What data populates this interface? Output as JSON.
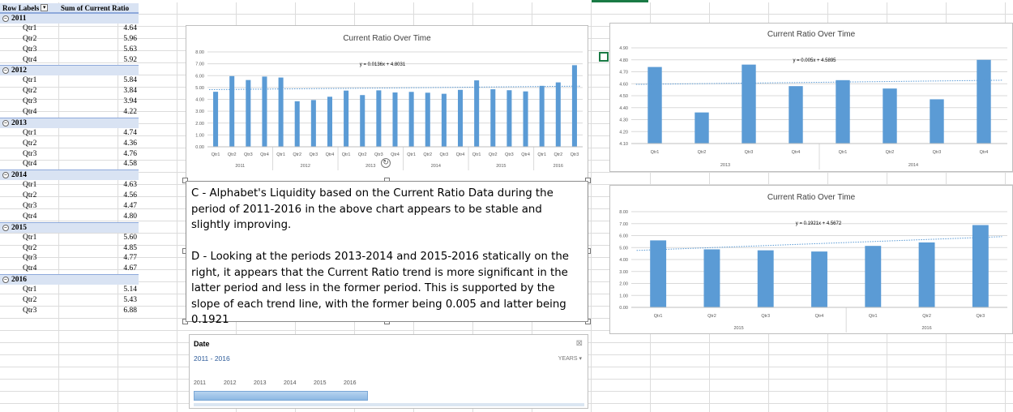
{
  "pivot": {
    "header_row_labels": "Row Labels",
    "header_sum": "Sum of Current Ratio",
    "filter_icon": "filter-icon",
    "years": [
      {
        "year": "2011",
        "rows": [
          {
            "q": "Qtr1",
            "v": "4.64"
          },
          {
            "q": "Qtr2",
            "v": "5.96"
          },
          {
            "q": "Qtr3",
            "v": "5.63"
          },
          {
            "q": "Qtr4",
            "v": "5.92"
          }
        ]
      },
      {
        "year": "2012",
        "rows": [
          {
            "q": "Qtr1",
            "v": "5.84"
          },
          {
            "q": "Qtr2",
            "v": "3.84"
          },
          {
            "q": "Qtr3",
            "v": "3.94"
          },
          {
            "q": "Qtr4",
            "v": "4.22"
          }
        ]
      },
      {
        "year": "2013",
        "rows": [
          {
            "q": "Qtr1",
            "v": "4.74"
          },
          {
            "q": "Qtr2",
            "v": "4.36"
          },
          {
            "q": "Qtr3",
            "v": "4.76"
          },
          {
            "q": "Qtr4",
            "v": "4.58"
          }
        ]
      },
      {
        "year": "2014",
        "rows": [
          {
            "q": "Qtr1",
            "v": "4.63"
          },
          {
            "q": "Qtr2",
            "v": "4.56"
          },
          {
            "q": "Qtr3",
            "v": "4.47"
          },
          {
            "q": "Qtr4",
            "v": "4.80"
          }
        ]
      },
      {
        "year": "2015",
        "rows": [
          {
            "q": "Qtr1",
            "v": "5.60"
          },
          {
            "q": "Qtr2",
            "v": "4.85"
          },
          {
            "q": "Qtr3",
            "v": "4.77"
          },
          {
            "q": "Qtr4",
            "v": "4.67"
          }
        ]
      },
      {
        "year": "2016",
        "rows": [
          {
            "q": "Qtr1",
            "v": "5.14"
          },
          {
            "q": "Qtr2",
            "v": "5.43"
          },
          {
            "q": "Qtr3",
            "v": "6.88"
          }
        ]
      }
    ]
  },
  "textbox": {
    "para_c": "C - Alphabet's Liquidity based on the Current Ratio Data during the period of 2011-2016 in the above chart appears to be stable and slightly improving.",
    "para_d": "D - Looking at the periods 2013-2014 and 2015-2016 statically on the right, it appears that the Current Ratio trend is more significant in the latter period and less in the former period. This is  supported by the slope of each trend line, with the former being 0.005 and latter being 0.1921"
  },
  "slicer": {
    "title": "Date",
    "range": "2011 - 2016",
    "level": "YEARS",
    "years": [
      "2011",
      "2012",
      "2013",
      "2014",
      "2015",
      "2016"
    ],
    "clear_icon": "clear-filter-icon"
  },
  "colors": {
    "bar": "#5b9bd5",
    "trend": "#5b9bd5",
    "accent": "#1a7a45"
  },
  "chart_data": [
    {
      "type": "bar",
      "title": "Current Ratio Over Time",
      "trendline_label": "y = 0.0136x + 4.8031",
      "trendline": {
        "slope": 0.0136,
        "intercept": 4.8031
      },
      "ylim": [
        0,
        8
      ],
      "yticks": [
        "0.00",
        "1.00",
        "2.00",
        "3.00",
        "4.00",
        "5.00",
        "6.00",
        "7.00",
        "8.00"
      ],
      "categories": [
        "Qtr1",
        "Qtr2",
        "Qtr3",
        "Qtr4",
        "Qtr1",
        "Qtr2",
        "Qtr3",
        "Qtr4",
        "Qtr1",
        "Qtr2",
        "Qtr3",
        "Qtr4",
        "Qtr1",
        "Qtr2",
        "Qtr3",
        "Qtr4",
        "Qtr1",
        "Qtr2",
        "Qtr3",
        "Qtr4",
        "Qtr1",
        "Qtr2",
        "Qtr3"
      ],
      "groups": [
        {
          "label": "2011",
          "count": 4
        },
        {
          "label": "2012",
          "count": 4
        },
        {
          "label": "2013",
          "count": 4
        },
        {
          "label": "2014",
          "count": 4
        },
        {
          "label": "2015",
          "count": 4
        },
        {
          "label": "2016",
          "count": 3
        }
      ],
      "values": [
        4.64,
        5.96,
        5.63,
        5.92,
        5.84,
        3.84,
        3.94,
        4.22,
        4.74,
        4.36,
        4.76,
        4.58,
        4.63,
        4.56,
        4.47,
        4.8,
        5.6,
        4.85,
        4.77,
        4.67,
        5.14,
        5.43,
        6.88
      ]
    },
    {
      "type": "bar",
      "title": "Current Ratio Over Time",
      "trendline_label": "y = 0.005x + 4.5895",
      "trendline": {
        "slope": 0.005,
        "intercept": 4.5895
      },
      "ylim": [
        4.1,
        4.9
      ],
      "yticks": [
        "4.10",
        "4.20",
        "4.30",
        "4.40",
        "4.50",
        "4.60",
        "4.70",
        "4.80",
        "4.90"
      ],
      "categories": [
        "Qtr1",
        "Qtr2",
        "Qtr3",
        "Qtr4",
        "Qtr1",
        "Qtr2",
        "Qtr3",
        "Qtr4"
      ],
      "groups": [
        {
          "label": "2013",
          "count": 4
        },
        {
          "label": "2014",
          "count": 4
        }
      ],
      "values": [
        4.74,
        4.36,
        4.76,
        4.58,
        4.63,
        4.56,
        4.47,
        4.8
      ]
    },
    {
      "type": "bar",
      "title": "Current Ratio Over Time",
      "trendline_label": "y = 0.1921x + 4.5672",
      "trendline": {
        "slope": 0.1921,
        "intercept": 4.5672
      },
      "ylim": [
        0,
        8
      ],
      "yticks": [
        "0.00",
        "1.00",
        "2.00",
        "3.00",
        "4.00",
        "5.00",
        "6.00",
        "7.00",
        "8.00"
      ],
      "categories": [
        "Qtr1",
        "Qtr2",
        "Qtr3",
        "Qtr4",
        "Qtr1",
        "Qtr2",
        "Qtr3"
      ],
      "groups": [
        {
          "label": "2015",
          "count": 4
        },
        {
          "label": "2016",
          "count": 3
        }
      ],
      "values": [
        5.6,
        4.85,
        4.77,
        4.67,
        5.14,
        5.43,
        6.88
      ]
    }
  ]
}
